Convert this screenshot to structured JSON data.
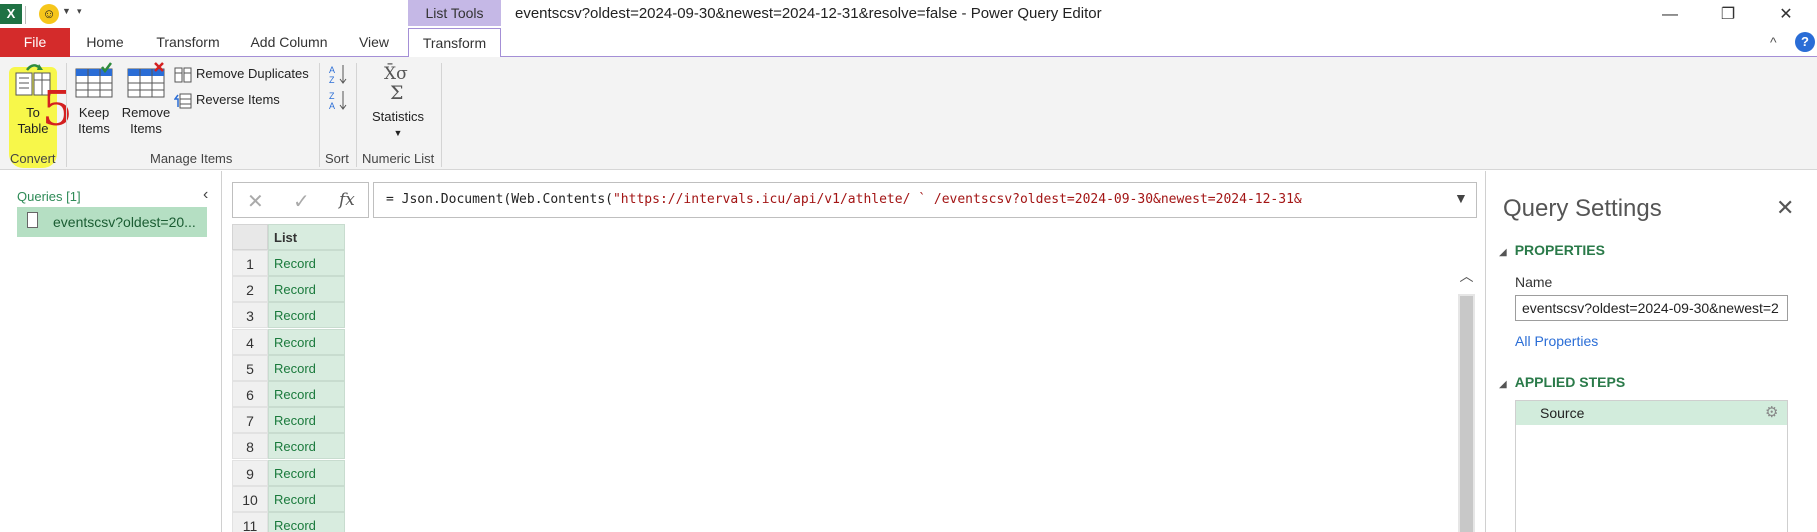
{
  "titlebar": {
    "app_logo": "X",
    "context_tab": "List Tools",
    "title": "eventscsv?oldest=2024-09-30&newest=2024-12-31&resolve=false - Power Query Editor",
    "controls": {
      "minimize": "—",
      "restore": "❐",
      "close": "✕"
    }
  },
  "tabs": {
    "file": "File",
    "home": "Home",
    "transform": "Transform",
    "add_column": "Add Column",
    "view": "View",
    "list_transform": "Transform"
  },
  "ribbon": {
    "convert": {
      "to_table_line1": "To",
      "to_table_line2": "Table",
      "group": "Convert",
      "annotation": "5"
    },
    "manage_items": {
      "keep_line1": "Keep",
      "keep_line2": "Items",
      "remove_line1": "Remove",
      "remove_line2": "Items",
      "remove_duplicates": "Remove Duplicates",
      "reverse_items": "Reverse Items",
      "group": "Manage Items"
    },
    "sort": {
      "group": "Sort"
    },
    "numeric_list": {
      "statistics": "Statistics",
      "group": "Numeric List"
    },
    "collapse": "^",
    "help": "?"
  },
  "queries": {
    "header": "Queries [1]",
    "items": [
      {
        "label": "eventscsv?oldest=20..."
      }
    ]
  },
  "formula_bar": {
    "cancel": "✕",
    "commit": "✓",
    "fx": "fx",
    "prefix": "= Json.Document(Web.Contents(",
    "string": "\"https://intervals.icu/api/v1/athlete/      ` /eventscsv?oldest=2024-09-30&newest=2024-12-31&"
  },
  "grid": {
    "column": "List",
    "rows": [
      {
        "num": "1",
        "value": "Record"
      },
      {
        "num": "2",
        "value": "Record"
      },
      {
        "num": "3",
        "value": "Record"
      },
      {
        "num": "4",
        "value": "Record"
      },
      {
        "num": "5",
        "value": "Record"
      },
      {
        "num": "6",
        "value": "Record"
      },
      {
        "num": "7",
        "value": "Record"
      },
      {
        "num": "8",
        "value": "Record"
      },
      {
        "num": "9",
        "value": "Record"
      },
      {
        "num": "10",
        "value": "Record"
      },
      {
        "num": "11",
        "value": "Record"
      }
    ]
  },
  "settings": {
    "title": "Query Settings",
    "properties_header": "PROPERTIES",
    "name_label": "Name",
    "name_value": "eventscsv?oldest=2024-09-30&newest=2",
    "all_properties": "All Properties",
    "applied_steps_header": "APPLIED STEPS",
    "steps": [
      {
        "label": "Source"
      }
    ]
  }
}
